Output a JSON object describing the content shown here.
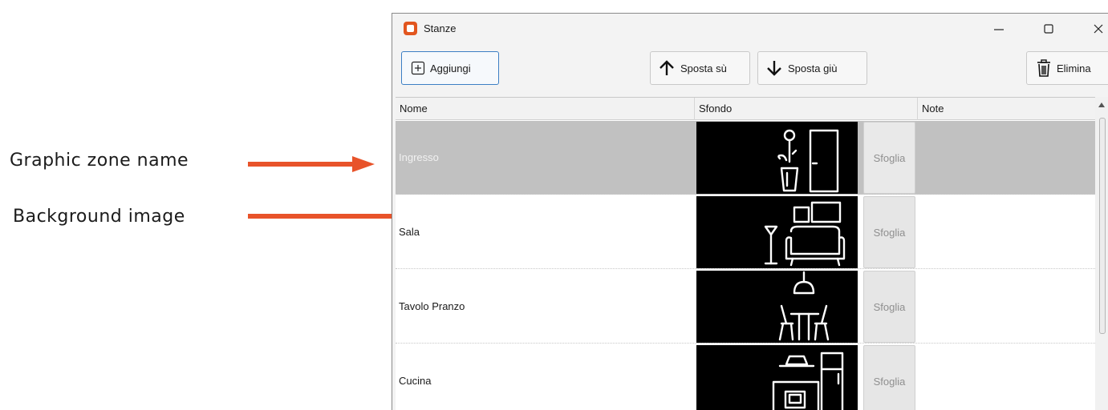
{
  "annotations": {
    "zone_name_label": "Graphic zone name",
    "background_label": "Background image",
    "arrow_color": "#e8532a"
  },
  "window": {
    "title": "Stanze",
    "icon": "app-icon",
    "controls": {
      "minimize": "minimize-icon",
      "maximize": "maximize-icon",
      "close": "close-icon"
    }
  },
  "toolbar": {
    "add_label": "Aggiungi",
    "add_icon": "plus-box-icon",
    "move_up_label": "Sposta sù",
    "move_up_icon": "arrow-up-icon",
    "move_down_label": "Sposta giù",
    "move_down_icon": "arrow-down-icon",
    "delete_label": "Elimina",
    "delete_icon": "trash-icon"
  },
  "grid": {
    "columns": [
      "Nome",
      "Sfondo",
      "Note"
    ],
    "browse_label": "Sfoglia",
    "selected_row_color": "#c1c1c1",
    "rows": [
      {
        "name": "Ingresso",
        "background_icon": "entrance-icon",
        "note": "",
        "selected": true
      },
      {
        "name": "Sala",
        "background_icon": "living-room-icon",
        "note": "",
        "selected": false
      },
      {
        "name": "Tavolo Pranzo",
        "background_icon": "dining-table-icon",
        "note": "",
        "selected": false
      },
      {
        "name": "Cucina",
        "background_icon": "kitchen-icon",
        "note": "",
        "selected": false
      }
    ]
  }
}
